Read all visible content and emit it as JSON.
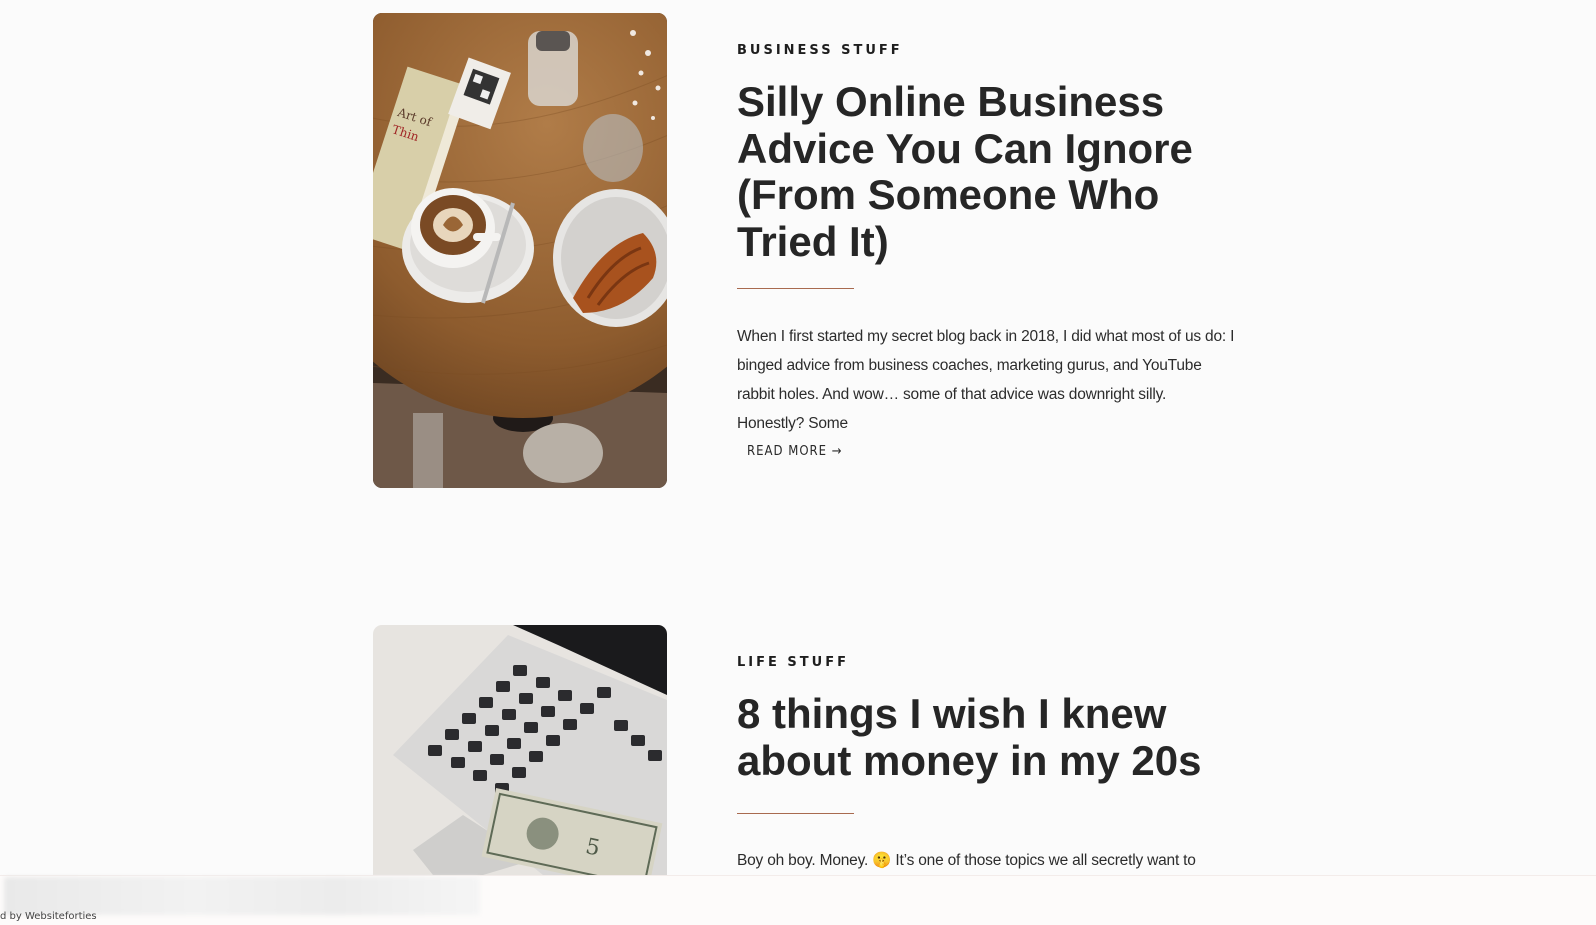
{
  "posts": [
    {
      "category": "BUSINESS STUFF",
      "title": "Silly Online Business Advice You Can Ignore (From Someone Who Tried It)",
      "excerpt": "When I first started my secret blog back in 2018, I did what most of us do: I binged advice from business coaches, marketing gurus, and YouTube rabbit holes. And wow… some of that advice was downright silly. Honestly? Some",
      "read_more": "READ MORE →",
      "image": "coffee-croissant-table"
    },
    {
      "category": "LIFE STUFF",
      "title": "8 things I wish I knew about money in my 20s",
      "excerpt": "Boy oh boy. Money. 🤫 It’s one of those topics we all secretly want to figure",
      "image": "laptop-cash"
    }
  ],
  "footer": {
    "credit": "d by Websiteforties"
  },
  "colors": {
    "background": "#fbfbfb",
    "text": "#262626",
    "divider": "#a86a4f"
  }
}
